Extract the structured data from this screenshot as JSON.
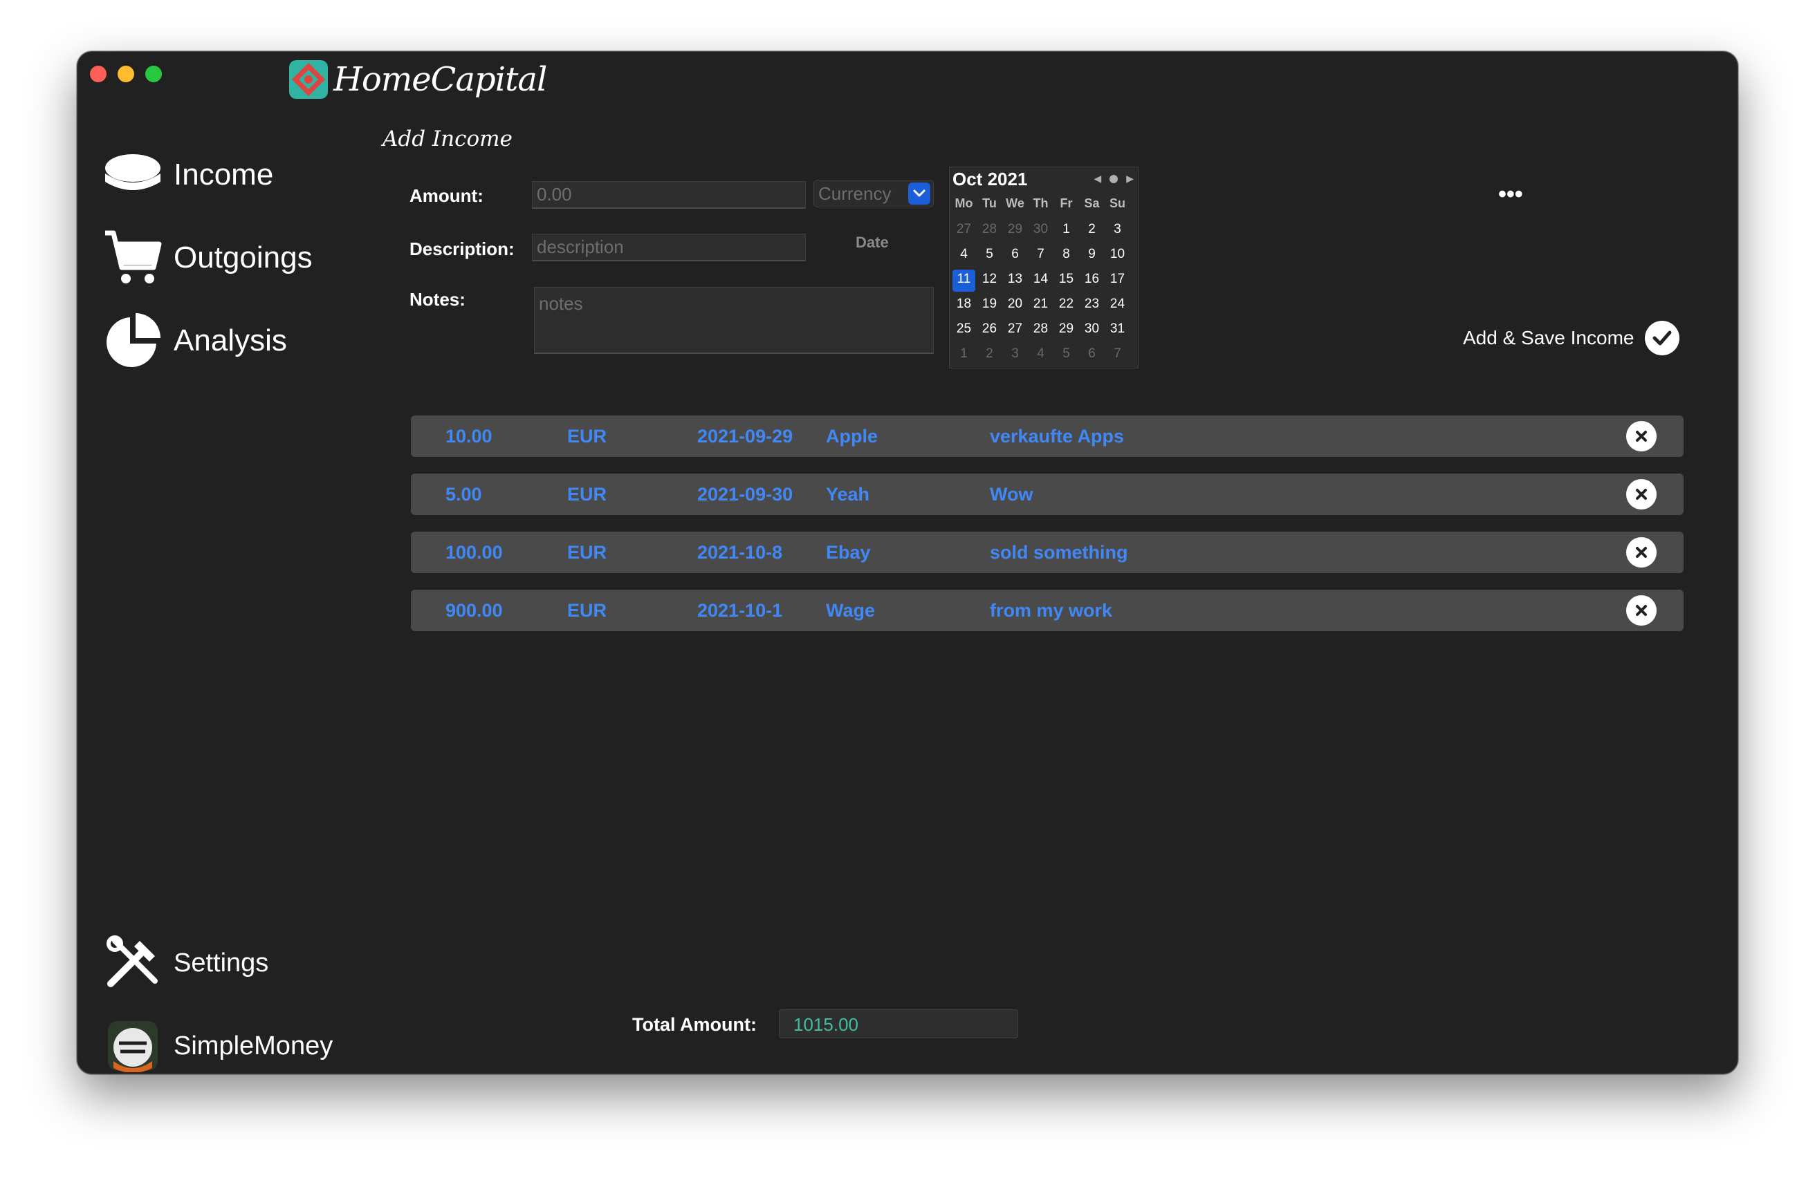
{
  "app": {
    "name": "HomeCapital"
  },
  "sidebar": {
    "items": [
      {
        "label": "Income",
        "icon": "coins-icon"
      },
      {
        "label": "Outgoings",
        "icon": "cart-icon"
      },
      {
        "label": "Analysis",
        "icon": "pie-chart-icon"
      }
    ],
    "bottom_items": [
      {
        "label": "Settings",
        "icon": "tools-icon"
      },
      {
        "label": "SimpleMoney",
        "icon": "simplemoney-app-icon"
      }
    ]
  },
  "form": {
    "title": "Add Income",
    "amount_label": "Amount:",
    "amount_placeholder": "0.00",
    "description_label": "Description:",
    "description_placeholder": "description",
    "notes_label": "Notes:",
    "notes_placeholder": "notes",
    "currency_placeholder": "Currency",
    "date_label": "Date",
    "more_label": "•••",
    "save_label": "Add & Save Income"
  },
  "calendar": {
    "month": "Oct 2021",
    "weekdays": [
      "Mo",
      "Tu",
      "We",
      "Th",
      "Fr",
      "Sa",
      "Su"
    ],
    "days": [
      {
        "d": "27",
        "m": true
      },
      {
        "d": "28",
        "m": true
      },
      {
        "d": "29",
        "m": true
      },
      {
        "d": "30",
        "m": true
      },
      {
        "d": "1"
      },
      {
        "d": "2"
      },
      {
        "d": "3"
      },
      {
        "d": "4"
      },
      {
        "d": "5"
      },
      {
        "d": "6"
      },
      {
        "d": "7"
      },
      {
        "d": "8"
      },
      {
        "d": "9"
      },
      {
        "d": "10"
      },
      {
        "d": "11",
        "s": true
      },
      {
        "d": "12"
      },
      {
        "d": "13"
      },
      {
        "d": "14"
      },
      {
        "d": "15"
      },
      {
        "d": "16"
      },
      {
        "d": "17"
      },
      {
        "d": "18"
      },
      {
        "d": "19"
      },
      {
        "d": "20"
      },
      {
        "d": "21"
      },
      {
        "d": "22"
      },
      {
        "d": "23"
      },
      {
        "d": "24"
      },
      {
        "d": "25"
      },
      {
        "d": "26"
      },
      {
        "d": "27"
      },
      {
        "d": "28"
      },
      {
        "d": "29"
      },
      {
        "d": "30"
      },
      {
        "d": "31"
      },
      {
        "d": "1",
        "m": true
      },
      {
        "d": "2",
        "m": true
      },
      {
        "d": "3",
        "m": true
      },
      {
        "d": "4",
        "m": true
      },
      {
        "d": "5",
        "m": true
      },
      {
        "d": "6",
        "m": true
      },
      {
        "d": "7",
        "m": true
      }
    ]
  },
  "income_list": [
    {
      "amount": "10.00",
      "currency": "EUR",
      "date": "2021-09-29",
      "name": "Apple",
      "note": "verkaufte Apps"
    },
    {
      "amount": "5.00",
      "currency": "EUR",
      "date": "2021-09-30",
      "name": "Yeah",
      "note": "Wow"
    },
    {
      "amount": "100.00",
      "currency": "EUR",
      "date": "2021-10-8",
      "name": "Ebay",
      "note": "sold something"
    },
    {
      "amount": "900.00",
      "currency": "EUR",
      "date": "2021-10-1",
      "name": "Wage",
      "note": "from my work"
    }
  ],
  "total": {
    "label": "Total Amount:",
    "value": "1015.00"
  },
  "colors": {
    "accent": "#3f88f6",
    "selection": "#1a5fd8",
    "total": "#3dbe9e",
    "background": "#212121"
  }
}
